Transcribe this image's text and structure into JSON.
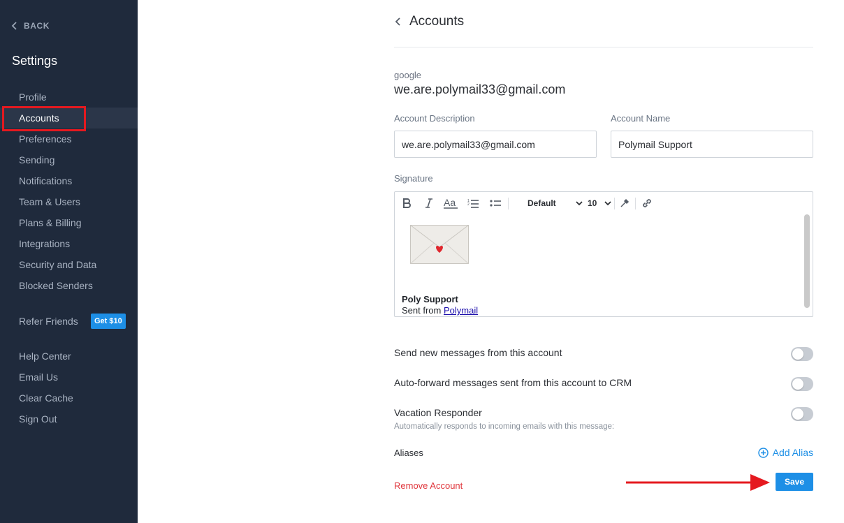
{
  "sidebar": {
    "back_label": "BACK",
    "title": "Settings",
    "items": [
      {
        "label": "Profile"
      },
      {
        "label": "Accounts"
      },
      {
        "label": "Preferences"
      },
      {
        "label": "Sending"
      },
      {
        "label": "Notifications"
      },
      {
        "label": "Team & Users"
      },
      {
        "label": "Plans & Billing"
      },
      {
        "label": "Integrations"
      },
      {
        "label": "Security and Data"
      },
      {
        "label": "Blocked Senders"
      }
    ],
    "refer_label": "Refer Friends",
    "refer_badge": "Get $10",
    "footer_items": [
      {
        "label": "Help Center"
      },
      {
        "label": "Email Us"
      },
      {
        "label": "Clear Cache"
      },
      {
        "label": "Sign Out"
      }
    ],
    "active_item": "Accounts"
  },
  "page": {
    "title": "Accounts",
    "provider": "google",
    "email": "we.are.polymail33@gmail.com"
  },
  "form": {
    "description_label": "Account Description",
    "description_value": "we.are.polymail33@gmail.com",
    "name_label": "Account Name",
    "name_value": "Polymail Support",
    "signature_label": "Signature"
  },
  "editor": {
    "font_select": "Default",
    "size_select": "10",
    "signature_name": "Poly Support",
    "signature_sent_prefix": "Sent from",
    "signature_link": "Polymail"
  },
  "settings": {
    "send_new": "Send new messages from this account",
    "auto_forward": "Auto-forward messages sent from this account to CRM",
    "vacation": "Vacation Responder",
    "vacation_sub": "Automatically responds to incoming emails with this message:",
    "toggles": {
      "send_new": false,
      "auto_forward": false,
      "vacation": false
    }
  },
  "aliases": {
    "label": "Aliases",
    "add_label": "Add Alias"
  },
  "actions": {
    "remove_label": "Remove Account",
    "save_label": "Save"
  },
  "colors": {
    "sidebar_bg": "#1f2a3c",
    "accent": "#1d8fe6",
    "danger": "#e0363c",
    "annotation_red": "#e5191f"
  }
}
